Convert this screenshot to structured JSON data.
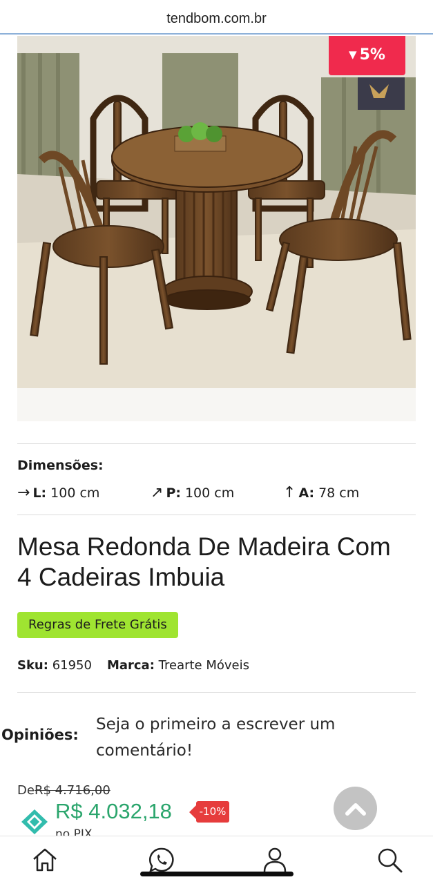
{
  "browser": {
    "url": "tendbom.com.br"
  },
  "product": {
    "discount_badge": "5%",
    "dimensions_title": "Dimensões:",
    "dimensions": [
      {
        "label": "L:",
        "value": "100 cm"
      },
      {
        "label": "P:",
        "value": "100 cm"
      },
      {
        "label": "A:",
        "value": "78 cm"
      }
    ],
    "title": "Mesa Redonda De Madeira Com 4 Cadeiras Imbuia",
    "shipping_button": "Regras de Frete Grátis",
    "sku_label": "Sku:",
    "sku_value": "61950",
    "brand_label": "Marca:",
    "brand_value": "Trearte Móveis"
  },
  "reviews": {
    "label": "Opiniões:",
    "prompt": "Seja o primeiro a escrever um comentário!"
  },
  "pricing": {
    "from_label": "De",
    "old_price": "R$ 4.716,00",
    "price": "R$ 4.032,18",
    "pix_discount": "-10%",
    "pix_label": "no PIX"
  },
  "bottom_nav": {
    "items": [
      "home-icon",
      "whatsapp-icon",
      "user-icon",
      "search-icon"
    ]
  },
  "colors": {
    "discount_badge": "#f02a4d",
    "shipping_button": "#9fe431",
    "price": "#2aa56c",
    "pix_badge": "#e63c3c",
    "pix_icon": "#32bcad"
  }
}
